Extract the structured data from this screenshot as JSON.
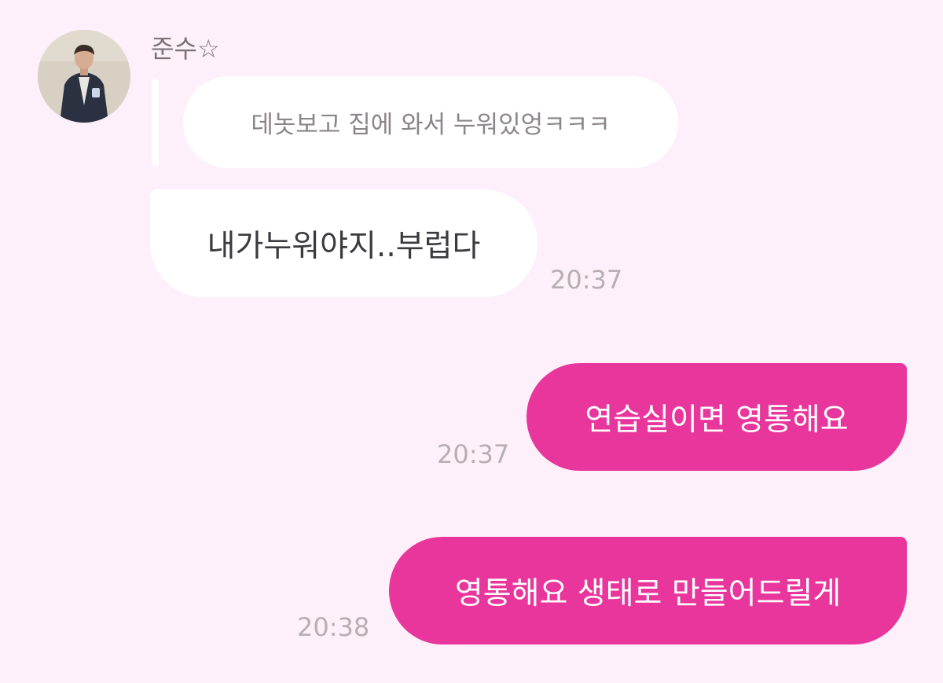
{
  "contact": {
    "name": "준수☆",
    "avatar_icon": "profile-photo"
  },
  "messages": [
    {
      "direction": "incoming",
      "quoted_text": "데놋보고 집에 와서 누워있엉ㅋㅋㅋ",
      "text": "내가누워야지..부럽다",
      "time": "20:37"
    },
    {
      "direction": "outgoing",
      "text": "연습실이면 영통해요",
      "time": "20:37"
    },
    {
      "direction": "outgoing",
      "text": "영통해요 생태로 만들어드릴게",
      "time": "20:38"
    }
  ],
  "colors": {
    "background": "#fdf0fa",
    "incoming_bubble": "#ffffff",
    "outgoing_bubble": "#e8369c",
    "timestamp": "#b6afb4"
  }
}
